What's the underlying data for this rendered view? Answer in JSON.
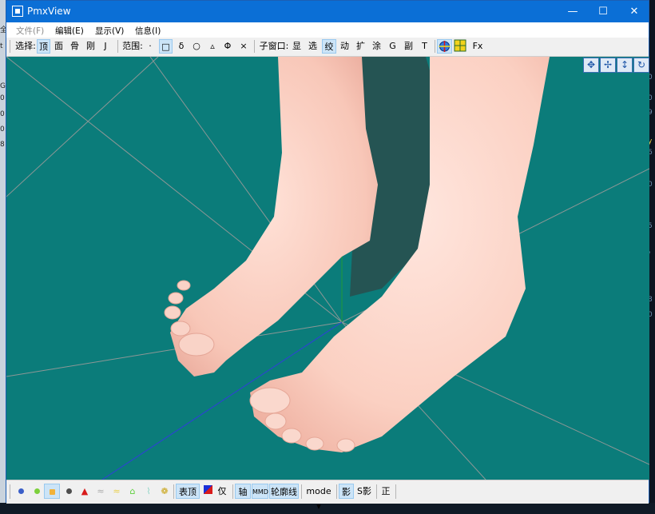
{
  "window": {
    "title": "PmxView"
  },
  "titlebar_buttons": {
    "minimize": "—",
    "maximize": "☐",
    "close": "✕"
  },
  "menu": [
    "文件(F)",
    "编辑(E)",
    "显示(V)",
    "信息(I)"
  ],
  "toolbar": {
    "select_label": "选择:",
    "select_items": [
      "顶",
      "面",
      "骨",
      "刚",
      "J"
    ],
    "range_label": "范围:",
    "range_items": [
      "·",
      "□",
      "δ",
      "○",
      "▵",
      "Φ",
      "×"
    ],
    "sub_label": "子窗口:",
    "sub_items": [
      "显",
      "选",
      "绞",
      "动",
      "扩",
      "涂",
      "G",
      "副",
      "T"
    ],
    "fx": "Fx"
  },
  "statusbar": {
    "vertex_toggle": "表顶",
    "only": "仅",
    "axis": "轴",
    "mmd": "MMD",
    "outline": "轮廓线",
    "mode": "mode ▾",
    "shadow": "影",
    "sshadow": "S影",
    "ortho": "正"
  },
  "left_bg_glyphs": [
    "全",
    "t",
    "G",
    "0",
    "0",
    "0",
    "8"
  ],
  "right_bg_glyphs": [
    "0",
    "0",
    "9",
    "y",
    "6",
    "0",
    "5",
    "/",
    "8",
    "0"
  ],
  "colors": {
    "viewport_bg": "#0b7c7a",
    "skin": "#f6c8b8",
    "titlebar": "#0b6fd6",
    "toolbar_active": "#cce4f7"
  }
}
